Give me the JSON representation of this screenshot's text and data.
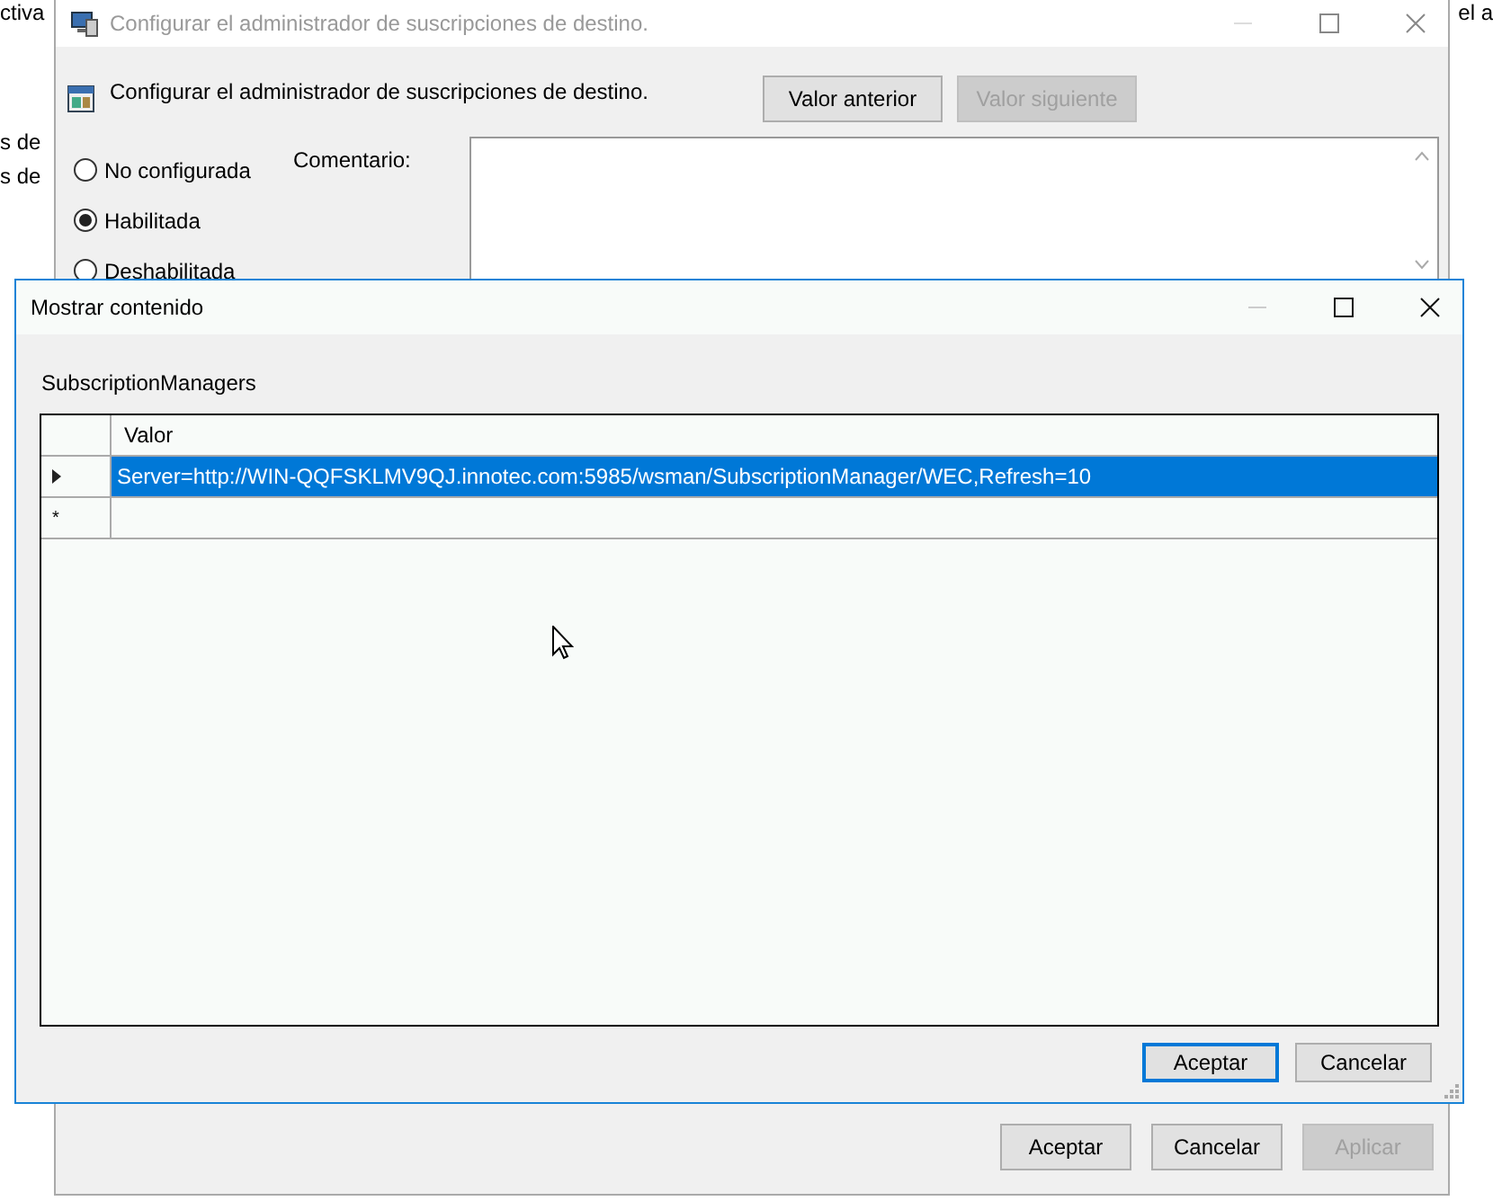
{
  "background": {
    "left_fragments": [
      "ctiva",
      "s de",
      "s de"
    ],
    "right_fragment": "el a"
  },
  "policy_window": {
    "title": "Configurar el administrador de suscripciones de destino.",
    "active": false,
    "heading": "Configurar el administrador de suscripciones de destino.",
    "nav_buttons": [
      {
        "label": "Valor anterior",
        "disabled": false
      },
      {
        "label": "Valor siguiente",
        "disabled": true
      }
    ],
    "options": [
      {
        "label": "No configurada",
        "selected": false
      },
      {
        "label": "Habilitada",
        "selected": true
      },
      {
        "label": "Deshabilitada",
        "selected": false
      }
    ],
    "comment_label": "Comentario:",
    "buttons": [
      {
        "label": "Aceptar",
        "disabled": false
      },
      {
        "label": "Cancelar",
        "disabled": false
      },
      {
        "label": "Aplicar",
        "disabled": true
      }
    ]
  },
  "dialog": {
    "title": "Mostrar contenido",
    "active": true,
    "list_name": "SubscriptionManagers",
    "column": "Valor",
    "rows": [
      {
        "kind": "current",
        "value": "Server=http://WIN-QQFSKLMV9QJ.innotec.com:5985/wsman/SubscriptionManager/WEC,Refresh=10",
        "selected": true
      },
      {
        "kind": "new",
        "marker": "*",
        "selected": false
      }
    ],
    "buttons": [
      {
        "label": "Aceptar",
        "default": true
      },
      {
        "label": "Cancelar",
        "default": false
      }
    ]
  }
}
